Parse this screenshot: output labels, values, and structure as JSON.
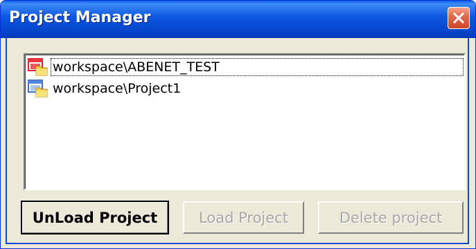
{
  "window": {
    "title": "Project Manager"
  },
  "projects": [
    {
      "label": "workspace\\ABENET_TEST",
      "icon": "project-loaded-icon",
      "selected": true
    },
    {
      "label": "workspace\\Project1",
      "icon": "project-icon",
      "selected": false
    }
  ],
  "buttons": {
    "unload_label": "UnLoad Project",
    "load_label": "Load Project",
    "delete_label": "Delete project"
  },
  "colors": {
    "titlebar": "#0a55e0",
    "body": "#ece9d8",
    "disabled_text": "#a7a7a7",
    "close_button": "#d0452a"
  }
}
